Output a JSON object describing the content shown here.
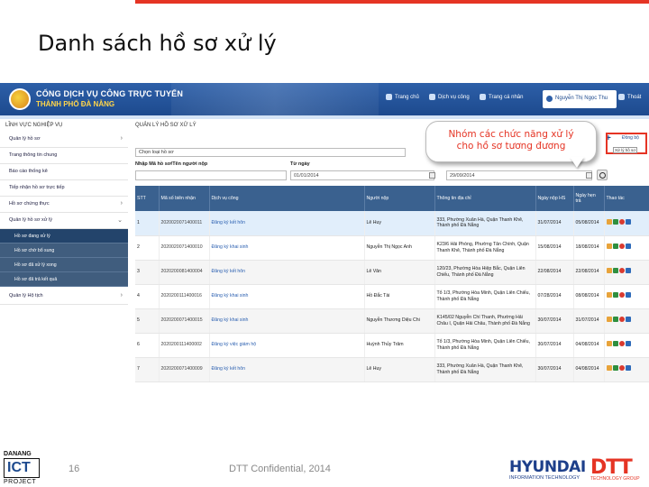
{
  "slide": {
    "title": "Danh sách hồ sơ xử lý",
    "page_number": "16",
    "footer_text": "DTT Confidential, 2014",
    "logos": {
      "left_line1": "DANANG",
      "left_line2": "ICT",
      "left_line3": "PROJECT",
      "hyundai": "HYUNDAI",
      "hyundai_sub": "INFORMATION TECHNOLOGY",
      "dtt": "DTT",
      "dtt_sub": "TECHNOLOGY GROUP"
    },
    "accent_color": "#e53424"
  },
  "portal": {
    "title_line1": "CỔNG DỊCH VỤ CÔNG TRỰC TUYẾN",
    "title_line2": "THÀNH PHỐ ĐÀ NẴNG",
    "nav": [
      "Trang chủ",
      "Dịch vụ công",
      "Trang cá nhân"
    ],
    "user": "Nguyễn Thị Ngọc Thu",
    "logout": "Thoát",
    "header_color": "#2d5fa8"
  },
  "sidebar": {
    "heading": "LĨNH VỰC NGHIỆP VỤ",
    "items": [
      {
        "label": "Quản lý hồ sơ",
        "has_arrow": true
      },
      {
        "label": "Trang thông tin chung",
        "has_arrow": false
      },
      {
        "label": "Báo cáo thống kê",
        "has_arrow": false
      },
      {
        "label": "Tiếp nhận hồ sơ trực tiếp",
        "has_arrow": false
      },
      {
        "label": "Hồ sơ chứng thực",
        "has_arrow": true
      },
      {
        "label": "Quản lý hồ sơ xử lý",
        "has_arrow": true
      }
    ],
    "subitems": [
      {
        "label": "Hồ sơ đang xử lý",
        "active": true
      },
      {
        "label": "Hồ sơ chờ bổ sung",
        "active": false
      },
      {
        "label": "Hồ sơ đã xử lý xong",
        "active": false
      },
      {
        "label": "Hồ sơ đã trả kết quả",
        "active": false
      }
    ],
    "last_item": "Quản lý Hộ tịch"
  },
  "main": {
    "heading": "QUẢN LÝ HỒ SƠ XỬ LÝ",
    "select_value": "Chọn loại hồ sơ",
    "code_label": "Nhập Mã hồ sơ/Tên người nộp",
    "from_label": "Từ ngày",
    "from_value": "01/01/2014",
    "to_value": "29/09/2014",
    "sync_link": "Đồng bộ",
    "plus": "+"
  },
  "callout": {
    "line1": "Nhóm các chức năng xử lý",
    "line2": "cho hồ sơ tương đương"
  },
  "tooltip": "Xử lý hồ sơ",
  "table": {
    "columns": [
      "STT",
      "Mã số biên nhận",
      "Dịch vụ công",
      "Người nộp",
      "Thông tin địa chỉ",
      "Ngày nộp HS",
      "Ngày hẹn trả",
      "Thao tác"
    ],
    "rows": [
      [
        "1",
        "2020020071400011",
        "Đăng ký kết hôn",
        "Lê Huy",
        "333, Phường Xuân Hà, Quận Thanh Khê, Thành phố Đà Nẵng",
        "31/07/2014",
        "05/08/2014"
      ],
      [
        "2",
        "2020020071400010",
        "Đăng ký khai sinh",
        "Nguyễn Thị Ngọc Anh",
        "K23/6 Hải Phòng, Phường Tân Chính, Quận Thanh Khê, Thành phố Đà Nẵng",
        "15/08/2014",
        "18/08/2014"
      ],
      [
        "3",
        "2020200081400004",
        "Đăng ký kết hôn",
        "Lê Văn",
        "120/23, Phường Hòa Hiệp Bắc, Quận Liên Chiểu, Thành phố Đà Nẵng",
        "22/08/2014",
        "22/08/2014"
      ],
      [
        "4",
        "2020200111400016",
        "Đăng ký khai sinh",
        "Hồ Đắc Tài",
        "Tổ 1/3, Phường Hòa Minh, Quận Liên Chiểu, Thành phố Đà Nẵng",
        "07/28/2014",
        "08/08/2014"
      ],
      [
        "5",
        "2020200071400015",
        "Đăng ký khai sinh",
        "Nguyễn Thương Diệu Chi",
        "K145/02 Nguyễn Chí Thanh, Phường Hải Châu I, Quận Hải Châu, Thành phố Đà Nẵng",
        "30/07/2014",
        "31/07/2014"
      ],
      [
        "6",
        "2020200111400002",
        "Đăng ký việc giám hộ",
        "Huỳnh Thủy Trâm",
        "Tổ 1/3, Phường Hòa Minh, Quận Liên Chiểu, Thành phố Đà Nẵng",
        "30/07/2014",
        "04/08/2014"
      ],
      [
        "7",
        "2020200071400009",
        "Đăng ký kết hôn",
        "Lê Huy",
        "333, Phường Xuân Hà, Quận Thanh Khê, Thành phố Đà Nẵng",
        "30/07/2014",
        "04/08/2014"
      ]
    ]
  }
}
